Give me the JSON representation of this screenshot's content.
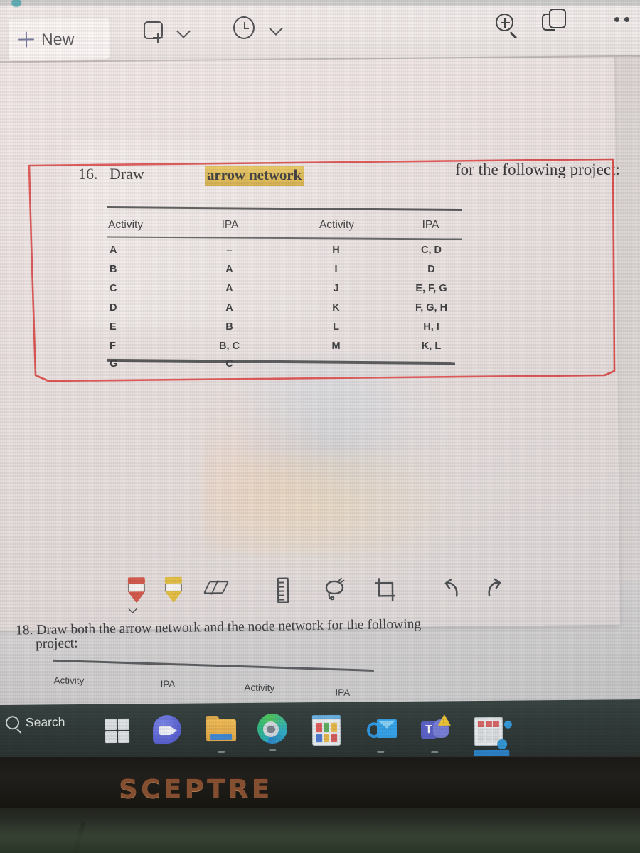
{
  "app": {
    "toolbar": {
      "new_button_label": "New",
      "new_note_icon": "new-note-icon",
      "new_note_chevron": "chevron-down-icon",
      "recent_icon": "clock-icon",
      "recent_chevron": "chevron-down-icon",
      "zoom_icon": "zoom-in-icon",
      "duplicate_icon": "copy-pages-icon",
      "more_icon": "more-options-icon"
    },
    "ink_toolbar": {
      "tools": [
        {
          "name": "red-pen-tool",
          "color": "#c73a2e",
          "has_chevron": true
        },
        {
          "name": "yellow-highlighter-tool",
          "color": "#e2b72c",
          "has_chevron": false
        },
        {
          "name": "eraser-tool",
          "color": "#35393d",
          "has_chevron": false
        },
        {
          "name": "ruler-tool",
          "color": "#35393d",
          "has_chevron": false
        },
        {
          "name": "lasso-select-tool",
          "color": "#35393d",
          "has_chevron": false
        },
        {
          "name": "crop-tool",
          "color": "#35393d",
          "has_chevron": false
        },
        {
          "name": "undo-button",
          "color": "#35393d",
          "has_chevron": false
        },
        {
          "name": "redo-button",
          "color": "#35393d",
          "has_chevron": false
        }
      ]
    }
  },
  "worksheet": {
    "question_16": {
      "number": "16.",
      "lead_text": "Draw",
      "highlighted_text": "arrow network",
      "after_highlight": ".",
      "trailing_text": "for the following project:",
      "highlight_color": "#dcb43d",
      "annotation": {
        "name": "red-rectangle-annotation",
        "color": "#d93b3b"
      },
      "table": {
        "headers": [
          "Activity",
          "IPA",
          "Activity",
          "IPA"
        ],
        "rows": [
          [
            "A",
            "–",
            "H",
            "C, D"
          ],
          [
            "B",
            "A",
            "I",
            "D"
          ],
          [
            "C",
            "A",
            "J",
            "E, F, G"
          ],
          [
            "D",
            "A",
            "K",
            "F, G, H"
          ],
          [
            "E",
            "B",
            "L",
            "H, I"
          ],
          [
            "F",
            "B, C",
            "M",
            "K, L"
          ],
          [
            "G",
            "C",
            "",
            ""
          ]
        ]
      }
    },
    "question_18": {
      "line1": "18. Draw both the arrow network and the node network for the following",
      "line2": "project:",
      "table": {
        "headers": [
          "Activity",
          "IPA",
          "Activity",
          "IPA"
        ]
      }
    }
  },
  "taskbar": {
    "search_label": "Search",
    "search_icon": "search-icon",
    "apps": [
      {
        "name": "start-button"
      },
      {
        "name": "microsoft-teams-chat"
      },
      {
        "name": "file-explorer",
        "running": true
      },
      {
        "name": "microsoft-edge",
        "running": true
      },
      {
        "name": "calendar-app"
      },
      {
        "name": "outlook-app",
        "running": true
      },
      {
        "name": "microsoft-teams-app",
        "running": true
      },
      {
        "name": "excel-app",
        "running": true
      }
    ]
  },
  "hardware": {
    "monitor_brand": "SCEPTRE"
  }
}
